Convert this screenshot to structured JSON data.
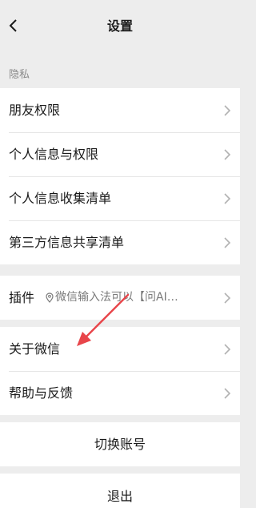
{
  "header": {
    "title": "设置",
    "back_icon": "chevron-left-icon"
  },
  "privacy": {
    "section_label": "隐私",
    "items": [
      {
        "label": "朋友权限"
      },
      {
        "label": "个人信息与权限"
      },
      {
        "label": "个人信息收集清单"
      },
      {
        "label": "第三方信息共享清单"
      }
    ]
  },
  "plugins": {
    "label": "插件",
    "subtitle": "微信输入法可以【问AI…",
    "subtitle_icon": "location-pin-icon"
  },
  "about": {
    "items": [
      {
        "label": "关于微信"
      },
      {
        "label": "帮助与反馈"
      }
    ]
  },
  "switch_account": {
    "label": "切换账号"
  },
  "logout": {
    "label": "退出"
  },
  "colors": {
    "background": "#ededed",
    "row": "#ffffff",
    "annotation_arrow": "#e8454a"
  }
}
